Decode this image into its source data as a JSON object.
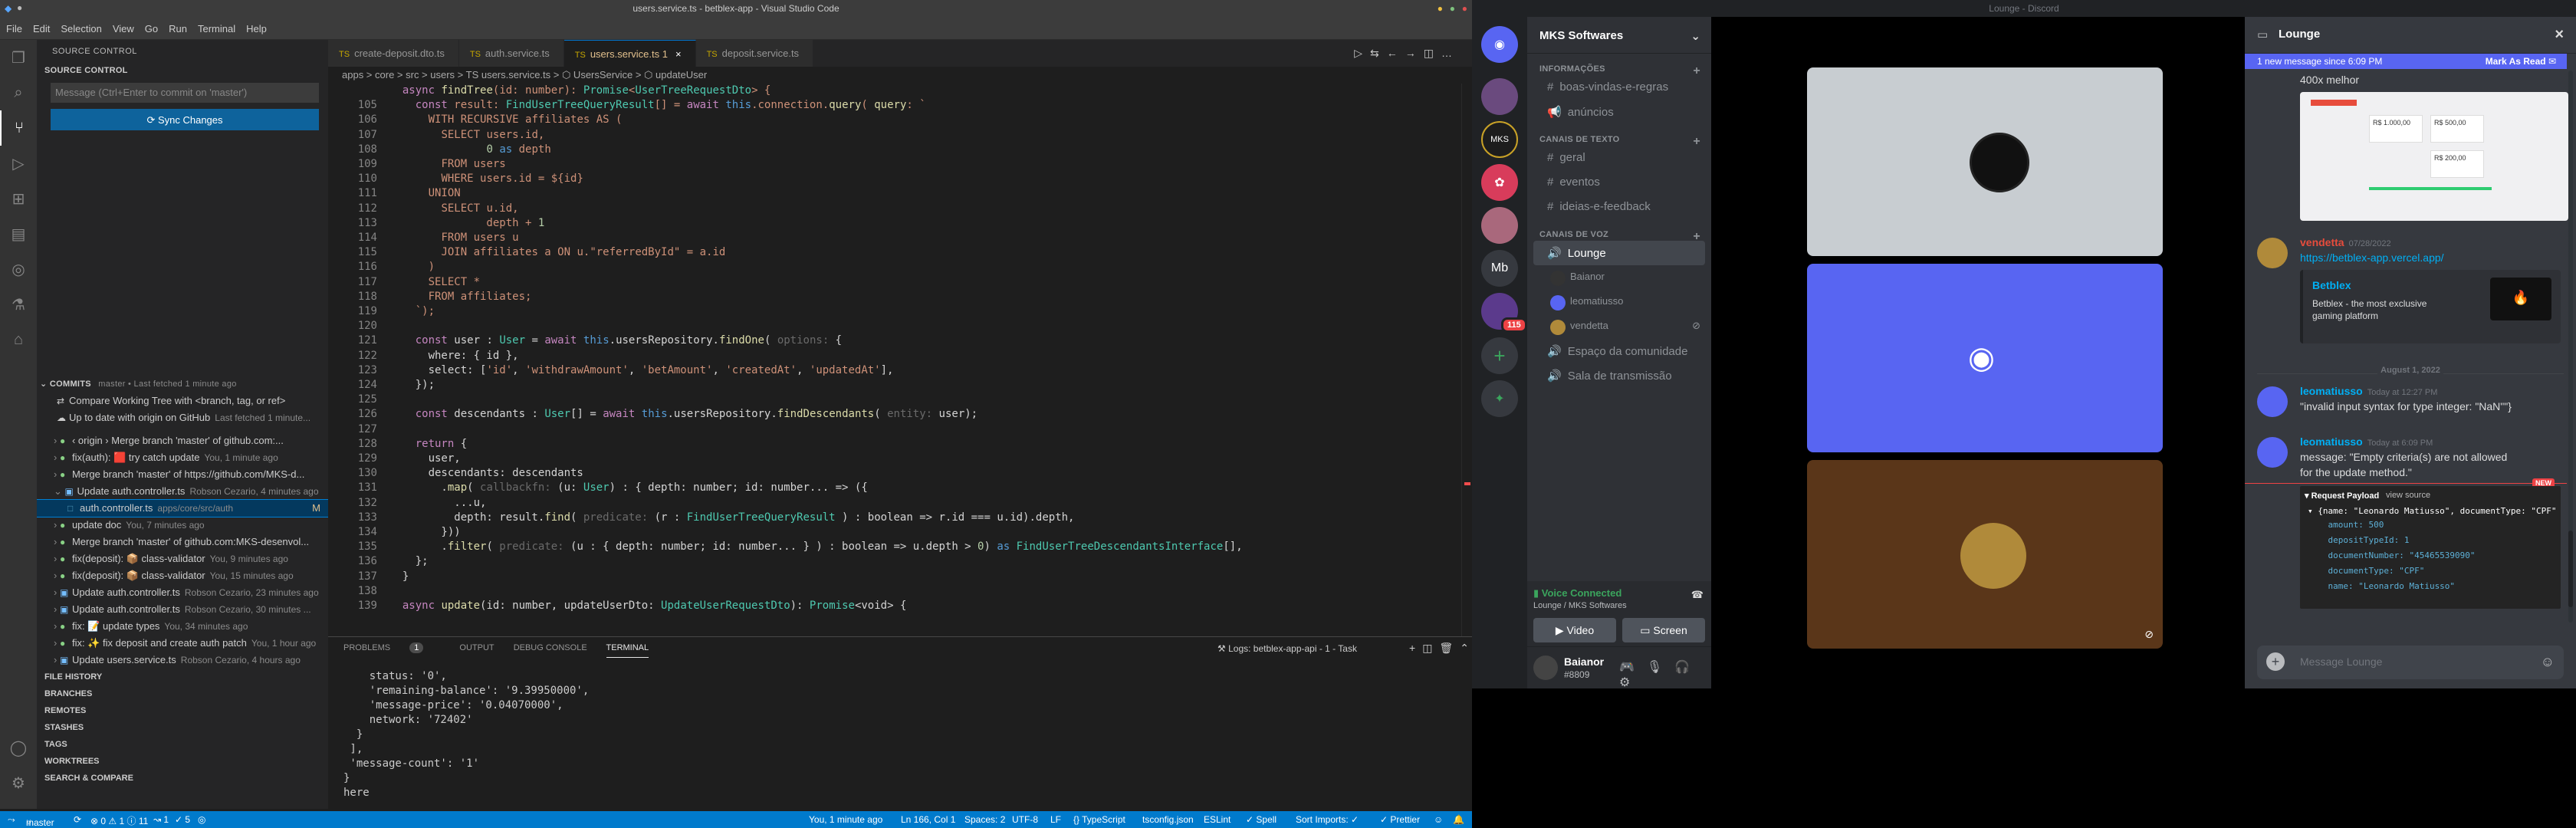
{
  "vscode": {
    "window_title": "users.service.ts - betblex-app - Visual Studio Code",
    "menu": [
      "File",
      "Edit",
      "Selection",
      "View",
      "Go",
      "Run",
      "Terminal",
      "Help"
    ],
    "sidebar": {
      "header": "SOURCE CONTROL",
      "section": "SOURCE CONTROL",
      "message_placeholder": "Message (Ctrl+Enter to commit on 'master')",
      "sync_button": "Sync Changes",
      "commits_title": "COMMITS",
      "commits_meta": "master • Last fetched 1 minute ago",
      "compare_item": "Compare Working Tree with <branch, tag, or ref>",
      "uptodate_item": "Up to date with origin on GitHub",
      "uptodate_meta": "Last fetched 1 minute...",
      "commits": [
        {
          "text": "‹ origin › Merge branch 'master' of github.com:...",
          "meta": "",
          "icon": "●"
        },
        {
          "text": "fix(auth): 🟥 try catch update",
          "meta": "You, 1 minute ago",
          "icon": "●"
        },
        {
          "text": "Merge branch 'master' of https://github.com/MKS-d...",
          "meta": "",
          "icon": "●"
        },
        {
          "text": "Update auth.controller.ts",
          "meta": "Robson Cezario, 4 minutes ago",
          "icon": "▣"
        },
        {
          "text": "auth.controller.ts",
          "meta": "apps/core/src/auth",
          "icon": "□"
        },
        {
          "text": "update doc",
          "meta": "You, 7 minutes ago",
          "icon": "●"
        },
        {
          "text": "Merge branch 'master' of github.com:MKS-desenvol...",
          "meta": "",
          "icon": "●"
        },
        {
          "text": "fix(deposit): 📦 class-validator",
          "meta": "You, 9 minutes ago",
          "icon": "●"
        },
        {
          "text": "fix(deposit): 📦 class-validator",
          "meta": "You, 15 minutes ago",
          "icon": "●"
        },
        {
          "text": "Update auth.controller.ts",
          "meta": "Robson Cezario, 23 minutes ago",
          "icon": "▣"
        },
        {
          "text": "Update auth.controller.ts",
          "meta": "Robson Cezario, 30 minutes ...",
          "icon": "▣"
        },
        {
          "text": "fix: 📝 update types",
          "meta": "You, 34 minutes ago",
          "icon": "●"
        },
        {
          "text": "fix: ✨ fix deposit and create auth patch",
          "meta": "You, 1 hour ago",
          "icon": "●"
        },
        {
          "text": "Update users.service.ts",
          "meta": "Robson Cezario, 4 hours ago",
          "icon": "▣"
        }
      ],
      "bottom_sections": [
        "FILE HISTORY",
        "BRANCHES",
        "REMOTES",
        "STASHES",
        "TAGS",
        "WORKTREES",
        "SEARCH & COMPARE"
      ]
    },
    "tabs": [
      {
        "label": "create-deposit.dto.ts",
        "active": false
      },
      {
        "label": "auth.service.ts",
        "active": false
      },
      {
        "label": "users.service.ts 1",
        "active": true
      },
      {
        "label": "deposit.service.ts",
        "active": false
      }
    ],
    "breadcrumb": "apps > core > src > users > TS users.service.ts > ⬡ UsersService > ⬡ updateUser",
    "code": [
      {
        "n": "",
        "c": "  async findTree(id: number): Promise<UserTreeRequestDto> {"
      },
      {
        "n": "105",
        "c": "    const result: FindUserTreeQueryResult[] = await this.connection.query( query: `"
      },
      {
        "n": "106",
        "c": "      WITH RECURSIVE affiliates AS ("
      },
      {
        "n": "107",
        "c": "        SELECT users.id,"
      },
      {
        "n": "108",
        "c": "               0 as depth"
      },
      {
        "n": "109",
        "c": "        FROM users"
      },
      {
        "n": "110",
        "c": "        WHERE users.id = ${id}"
      },
      {
        "n": "111",
        "c": "      UNION"
      },
      {
        "n": "112",
        "c": "        SELECT u.id,"
      },
      {
        "n": "113",
        "c": "               depth + 1"
      },
      {
        "n": "114",
        "c": "        FROM users u"
      },
      {
        "n": "115",
        "c": "        JOIN affiliates a ON u.\"referredById\" = a.id"
      },
      {
        "n": "116",
        "c": "      )"
      },
      {
        "n": "117",
        "c": "      SELECT *"
      },
      {
        "n": "118",
        "c": "      FROM affiliates;"
      },
      {
        "n": "119",
        "c": "    `);"
      },
      {
        "n": "120",
        "c": ""
      },
      {
        "n": "121",
        "c": "    const user : User = await this.usersRepository.findOne( options: {"
      },
      {
        "n": "122",
        "c": "      where: { id },"
      },
      {
        "n": "123",
        "c": "      select: ['id', 'withdrawAmount', 'betAmount', 'createdAt', 'updatedAt'],"
      },
      {
        "n": "124",
        "c": "    });"
      },
      {
        "n": "125",
        "c": ""
      },
      {
        "n": "126",
        "c": "    const descendants : User[] = await this.usersRepository.findDescendants( entity: user);"
      },
      {
        "n": "127",
        "c": ""
      },
      {
        "n": "128",
        "c": "    return {"
      },
      {
        "n": "129",
        "c": "      user,"
      },
      {
        "n": "130",
        "c": "      descendants: descendants"
      },
      {
        "n": "131",
        "c": "        .map( callbackfn: (u: User) : { depth: number; id: number... => ({"
      },
      {
        "n": "132",
        "c": "          ...u,"
      },
      {
        "n": "133",
        "c": "          depth: result.find( predicate: (r : FindUserTreeQueryResult ) : boolean => r.id === u.id).depth,"
      },
      {
        "n": "134",
        "c": "        }))"
      },
      {
        "n": "135",
        "c": "        .filter( predicate: (u : { depth: number; id: number... } ) : boolean => u.depth > 0) as FindUserTreeDescendantsInterface[],"
      },
      {
        "n": "136",
        "c": "    };"
      },
      {
        "n": "137",
        "c": "  }"
      },
      {
        "n": "138",
        "c": ""
      },
      {
        "n": "139",
        "c": "  async update(id: number, updateUserDto: UpdateUserRequestDto): Promise<void> {"
      }
    ],
    "panel": {
      "tabs": [
        "PROBLEMS",
        "OUTPUT",
        "DEBUG CONSOLE",
        "TERMINAL"
      ],
      "problems_count": "1",
      "task_label": "Logs: betblex-app-api - 1 - Task",
      "terminal": "    status: '0',\n    'remaining-balance': '9.39950000',\n    'message-price': '0.04070000',\n    network: '72402'\n  }\n ],\n 'message-count': '1'\n}\nhere"
    },
    "status": {
      "branch": "master",
      "problems": "⊗ 0 ⚠ 1 ⓘ 11",
      "ports": "↝ 1",
      "checks": "✓ 5",
      "blame": "You, 1 minute ago",
      "position": "Ln 166, Col 1",
      "spaces": "Spaces: 2",
      "encoding": "UTF-8",
      "eol": "LF",
      "language": "{} TypeScript",
      "tsconfig": "tsconfig.json",
      "eslint": "ESLint",
      "spell": "✓ Spell",
      "sort": "Sort Imports: ✓",
      "prettier": "✓ Prettier"
    }
  },
  "discord": {
    "window_title": "Lounge - Discord",
    "server_name": "MKS Softwares",
    "guild_badge": "115",
    "guild_text": "Mb",
    "categories": [
      {
        "name": "INFORMAÇÕES",
        "channels": [
          "boas-vindas-e-regras",
          "anúncios"
        ]
      },
      {
        "name": "CANAIS DE TEXTO",
        "channels": [
          "geral",
          "eventos",
          "ideias-e-feedback"
        ]
      },
      {
        "name": "CANAIS DE VOZ",
        "channels": [
          "Lounge"
        ]
      }
    ],
    "voice_users": [
      "Baianor",
      "leomatiusso",
      "vendetta"
    ],
    "other_voice": [
      "Espaço da comunidade",
      "Sala de transmissão"
    ],
    "voice_status": "Voice Connected",
    "voice_sub": "Lounge / MKS Softwares",
    "video_btn": "Video",
    "screen_btn": "Screen",
    "user_name": "Baianor",
    "user_tag": "#8809",
    "chat": {
      "channel": "Lounge",
      "new_banner": "1 new message since 6:09 PM",
      "mark_read": "Mark As Read",
      "msg0": "400x melhor",
      "m1_name": "vendetta",
      "m1_time": "07/28/2022",
      "m1_link": "https://betblex-app.vercel.app/",
      "embed_title": "Betblex",
      "embed_desc": "Betblex - the most exclusive gaming platform",
      "date_divider": "August 1, 2022",
      "m2_name": "leomatiusso",
      "m2_time": "Today at 12:27 PM",
      "m2_text": "\"invalid input syntax for type integer: \"NaN\"\"}",
      "m3_name": "leomatiusso",
      "m3_time": "Today at 6:09 PM",
      "m3_text_a": "message: \"Empty criteria(s) are not allowed",
      "m3_text_b": "for the update method.\"",
      "new_label": "NEW",
      "payload_title": "▾ Request Payload",
      "payload_view": "view source",
      "payload_lines": [
        "▾ {name: \"Leonardo Matiusso\", documentType: \"CPF\"",
        "    amount: 500",
        "    depositTypeId: 1",
        "    documentNumber: \"45465539090\"",
        "    documentType: \"CPF\"",
        "    name: \"Leonardo Matiusso\""
      ],
      "shot_values": [
        "R$ 1.000,00",
        "R$ 500,00",
        "R$ 200,00"
      ],
      "input_placeholder": "Message Lounge"
    }
  }
}
